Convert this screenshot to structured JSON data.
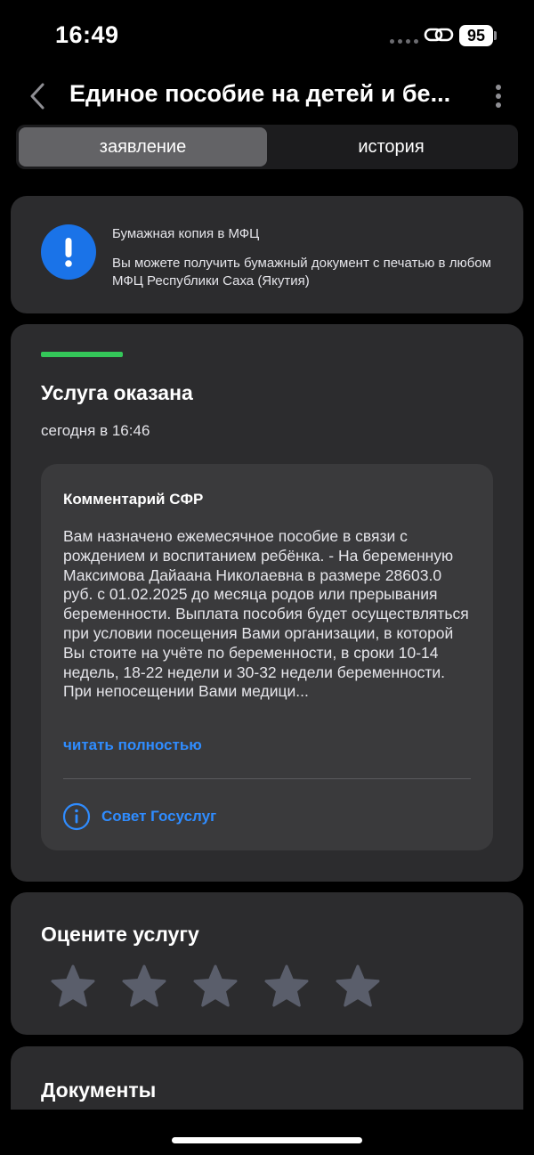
{
  "status_bar": {
    "time": "16:49",
    "battery": "95"
  },
  "header": {
    "title": "Единое пособие на детей и бе..."
  },
  "tabs": [
    {
      "label": "заявление",
      "active": true
    },
    {
      "label": "история",
      "active": false
    }
  ],
  "notice": {
    "icon": "exclamation-icon",
    "title": "Бумажная копия в МФЦ",
    "text": "Вы можете получить бумажный документ с печатью в любом МФЦ Республики Саха (Якутия)"
  },
  "status": {
    "progress_color": "#34c759",
    "title": "Услуга оказана",
    "date": "сегодня в 16:46",
    "comment": {
      "title": "Комментарий СФР",
      "text": "Вам назначено ежемесячное пособие в связи с рождением и воспитанием ребёнка. - На беременную Максимова Дайаана Николаевна в размере 28603.0 руб. с 01.02.2025 до месяца родов или прерывания беременности. Выплата пособия будет осуществляться при условии посещения Вами организации, в которой Вы стоите на учёте по беременности, в сроки 10-14 недель, 18-22 недели и 30-32 недели беременности. При непосещении Вами медици...",
      "read_more": "читать полностью",
      "advice": "Совет Госуслуг"
    }
  },
  "rating": {
    "title": "Оцените услугу",
    "stars": 0,
    "max_stars": 5
  },
  "documents": {
    "title": "Документы"
  },
  "colors": {
    "accent": "#2f8cff",
    "card": "#2c2c2e",
    "notice_icon": "#1a73e8"
  }
}
